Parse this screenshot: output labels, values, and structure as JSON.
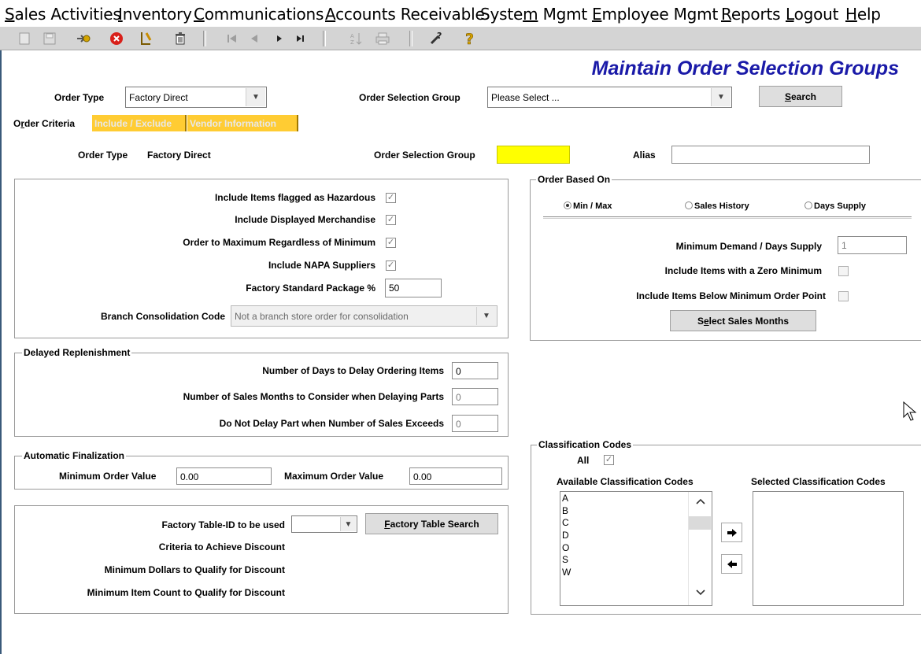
{
  "menu": [
    {
      "pre": "",
      "u": "S",
      "post": "ales Activities"
    },
    {
      "pre": "",
      "u": "I",
      "post": "nventory"
    },
    {
      "pre": "",
      "u": "C",
      "post": "ommunications"
    },
    {
      "pre": "",
      "u": "A",
      "post": "ccounts Receivable"
    },
    {
      "pre": "Syste",
      "u": "m",
      "post": " Mgmt"
    },
    {
      "pre": "",
      "u": "E",
      "post": "mployee Mgmt"
    },
    {
      "pre": "",
      "u": "R",
      "post": "eports"
    },
    {
      "pre": "",
      "u": "L",
      "post": "ogout"
    },
    {
      "pre": "",
      "u": "H",
      "post": "elp"
    }
  ],
  "toolbar_icons": [
    "new-icon",
    "save-icon",
    "go-icon",
    "cancel-icon",
    "edit-icon",
    "delete-icon",
    "first-record-icon",
    "previous-record-icon",
    "next-record-icon",
    "last-record-icon",
    "sort-icon",
    "print-icon",
    "wizard-icon",
    "help-icon"
  ],
  "page_title": "Maintain Order Selection Groups",
  "header": {
    "order_type_label": "Order Type",
    "order_type_value": "Factory Direct",
    "osg_label": "Order Selection Group",
    "osg_value": "Please Select ...",
    "search_pre": "",
    "search_u": "S",
    "search_post": "earch"
  },
  "tabs": {
    "order_criteria_pre": "O",
    "order_criteria_u": "r",
    "order_criteria_post": "der Criteria",
    "include_exclude": "Include / Exclude",
    "vendor_info": "Vendor Information"
  },
  "summary": {
    "order_type_label": "Order Type",
    "order_type_value": "Factory Direct",
    "osg_label": "Order Selection Group",
    "osg_value": "",
    "alias_label": "Alias",
    "alias_value": ""
  },
  "criteria": {
    "hazardous_label": "Include Items flagged as Hazardous",
    "hazardous_checked": true,
    "displayed_label": "Include Displayed Merchandise",
    "displayed_checked": true,
    "order_max_label": "Order to Maximum Regardless of Minimum",
    "order_max_checked": true,
    "napa_label": "Include NAPA Suppliers",
    "napa_checked": true,
    "factory_pkg_label": "Factory Standard Package %",
    "factory_pkg_value": "50",
    "branch_label": "Branch Consolidation Code",
    "branch_value": "Not a branch store order for consolidation"
  },
  "delayed": {
    "legend": "Delayed Replenishment",
    "days_label": "Number of Days to Delay Ordering Items",
    "days_value": "0",
    "months_label": "Number of Sales Months to Consider when Delaying Parts",
    "months_value": "0",
    "exceeds_label": "Do Not Delay Part when Number of Sales Exceeds",
    "exceeds_value": "0"
  },
  "finalization": {
    "legend": "Automatic Finalization",
    "min_label": "Minimum Order Value",
    "min_value": "0.00",
    "max_label": "Maximum Order Value",
    "max_value": "0.00"
  },
  "factory": {
    "table_label": "Factory Table-ID to be used",
    "table_value": "",
    "search_pre": "",
    "search_u": "F",
    "search_post": "actory Table Search",
    "criteria_label": "Criteria to Achieve Discount",
    "min_dollars_label": "Minimum Dollars to Qualify for Discount",
    "min_items_label": "Minimum Item Count to Qualify for Discount"
  },
  "order_based_on": {
    "legend": "Order Based On",
    "options": [
      "Min / Max",
      "Sales History",
      "Days Supply"
    ],
    "selected": "Min / Max",
    "min_demand_label": "Minimum Demand / Days Supply",
    "min_demand_value": "1",
    "zero_min_label": "Include Items with a Zero Minimum",
    "below_min_label": "Include Items Below Minimum Order Point",
    "select_months_pre": "S",
    "select_months_u": "e",
    "select_months_post": "lect Sales Months"
  },
  "classification": {
    "legend": "Classification Codes",
    "all_label": "All",
    "all_checked": true,
    "available_label": "Available Classification Codes",
    "selected_label": "Selected Classification Codes",
    "available": [
      "A",
      "B",
      "C",
      "D",
      "O",
      "S",
      "W"
    ],
    "selected": []
  }
}
